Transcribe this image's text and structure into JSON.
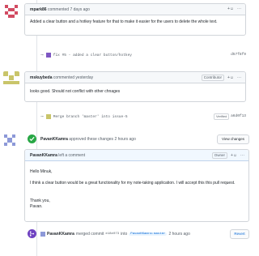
{
  "colors": {
    "green": "#28a745",
    "purple": "#6f42c1",
    "link": "#0366d6",
    "border": "#d1d5da",
    "header_bg": "#f6f8fa",
    "header_blue": "#f1f8ff"
  },
  "comment1": {
    "author": "mpark86",
    "meta": "commented 7 days ago",
    "body": "Added a clear button and a hotkey feature for that to make it easier for the users to delete the whole text.",
    "reaction": "+☺",
    "more": "···"
  },
  "commit1": {
    "message": "fix #5 - added a clear button/hotkey",
    "sha": "d57f8f9"
  },
  "comment2": {
    "author": "mskuybeda",
    "meta": "commented yesterday",
    "badge": "Contributor",
    "body": "looks good. Should not conflict with other chnages",
    "reaction": "+☺",
    "more": "···"
  },
  "commit2": {
    "message": "Merge branch 'master' into issue-5",
    "verified": "Verified",
    "sha": "a6d0f13"
  },
  "review": {
    "author": "PavanKKamra",
    "text": "approved these changes 2 hours ago",
    "button": "View changes"
  },
  "comment3": {
    "author": "PavanKKamra",
    "meta": "left a comment",
    "badge": "Owner",
    "greeting": "Hello Minuk,",
    "body": "I think a clear button would be a great functionality for my note-taking application. I will accept this this pull request.",
    "thanks": "Thank you,",
    "signature": "Pavan.",
    "reaction": "+☺",
    "more": "···"
  },
  "merge": {
    "author": "PavanKKamra",
    "text": "merged commit",
    "sha": "e18e073",
    "into": "into",
    "branch": "PavanKKamra:master",
    "time": "2 hours ago",
    "button": "Revert"
  }
}
